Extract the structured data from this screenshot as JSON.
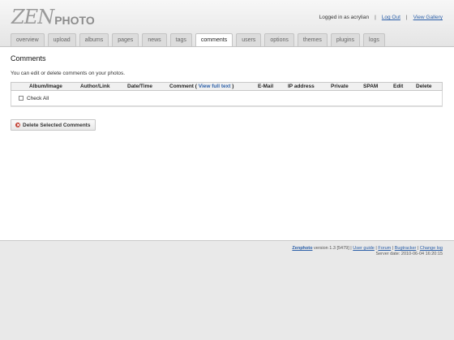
{
  "header": {
    "logo_zen": "ZEN",
    "logo_photo": "PHOTO",
    "logged_in_text": "Logged in as acrylian",
    "logout_label": "Log Out",
    "view_gallery_label": "View Gallery",
    "separator": "|"
  },
  "tabs": [
    {
      "label": "overview"
    },
    {
      "label": "upload"
    },
    {
      "label": "albums"
    },
    {
      "label": "pages"
    },
    {
      "label": "news"
    },
    {
      "label": "tags"
    },
    {
      "label": "comments",
      "active": true
    },
    {
      "label": "users"
    },
    {
      "label": "options"
    },
    {
      "label": "themes"
    },
    {
      "label": "plugins"
    },
    {
      "label": "logs"
    }
  ],
  "main": {
    "title": "Comments",
    "intro": "You can edit or delete comments on your photos.",
    "columns": {
      "album_image": "Album/Image",
      "author_link": "Author/Link",
      "date_time": "Date/Time",
      "comment": "Comment (",
      "view_full_text": "View full text",
      "comment_close": ")",
      "email": "E-Mail",
      "ip_address": "IP address",
      "private": "Private",
      "spam": "SPAM",
      "edit": "Edit",
      "delete": "Delete"
    },
    "check_all_label": "Check All",
    "delete_selected_label": "Delete Selected Comments"
  },
  "footer": {
    "zenphoto_link": "Zenphoto",
    "version": "version 1.3 [5479]",
    "user_guide": "User guide",
    "forum": "Forum",
    "bugtracker": "Bugtracker",
    "changelog": "Change log",
    "server_date": "Server date: 2010-06-04 16:20:15"
  },
  "colors": {
    "link": "#2b5fa8",
    "background": "#e9e9e9",
    "panel": "#ffffff",
    "delete_icon": "#c0392b"
  },
  "icons": {
    "delete_icon": "x-circle-icon"
  }
}
